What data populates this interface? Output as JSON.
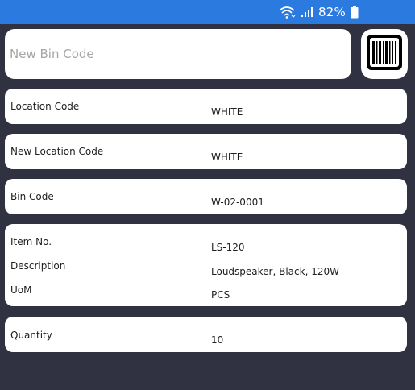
{
  "status_bar": {
    "battery": "82%"
  },
  "bin_input": {
    "placeholder": "New Bin Code"
  },
  "fields": {
    "location_code": {
      "label": "Location Code",
      "value": "WHITE"
    },
    "new_location_code": {
      "label": "New Location Code",
      "value": "WHITE"
    },
    "bin_code": {
      "label": "Bin Code",
      "value": "W-02-0001"
    },
    "item_no": {
      "label": "Item No.",
      "value": "LS-120"
    },
    "description": {
      "label": "Description",
      "value": "Loudspeaker, Black, 120W"
    },
    "uom": {
      "label": "UoM",
      "value": "PCS"
    },
    "quantity": {
      "label": "Quantity",
      "value": "10"
    }
  },
  "colors": {
    "status_bar": "#2b7ae0",
    "background": "#303242",
    "card": "#ffffff"
  },
  "icons": {
    "wifi": "wifi-icon",
    "signal": "signal-icon",
    "battery": "battery-icon",
    "barcode": "barcode-icon"
  }
}
